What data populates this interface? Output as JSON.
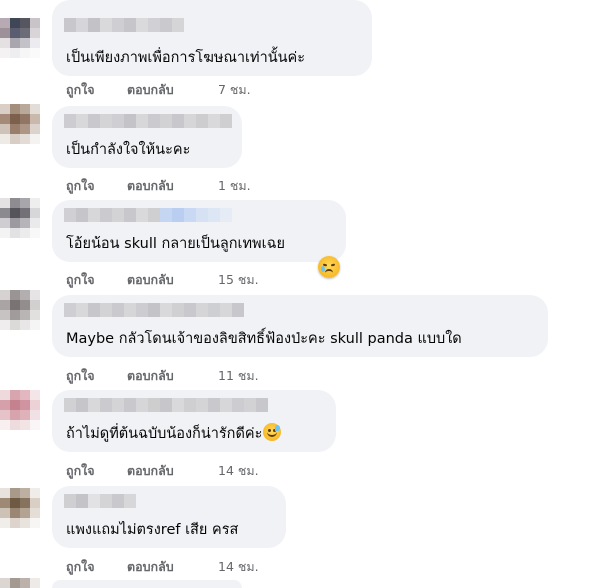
{
  "actions": {
    "like_label": "ถูกใจ",
    "reply_label": "ตอบกลับ"
  },
  "comments": [
    {
      "text": "เป็นเพียงภาพเพื่อการโฆษณาเท่านั้นค่ะ",
      "time": "7 ชม.",
      "emoji": null,
      "reaction": null
    },
    {
      "text": "เป็นกำลังใจให้นะคะ",
      "time": "1 ชม.",
      "emoji": null,
      "reaction": null
    },
    {
      "text": "โอ้ยน้อน skull กลายเป็นลูกเทพเฉย",
      "time": "15 ชม.",
      "emoji": null,
      "reaction": "sad-tear-icon"
    },
    {
      "text": "Maybe กลัวโดนเจ้าของลิขสิทธิ์ฟ้องป่ะคะ skull panda แบบใด",
      "time": "11 ชม.",
      "emoji": null,
      "reaction": null
    },
    {
      "text": "ถ้าไม่ดูที่ต้นฉบับน้องก็น่ารักดีค่ะ",
      "time": "14 ชม.",
      "emoji": "grinning-sweat-icon",
      "reaction": null
    },
    {
      "text": "แพงแถมไม่ตรงref เสีย ครส",
      "time": "14 ชม.",
      "emoji": null,
      "reaction": null
    }
  ],
  "colors": {
    "bubble": "#f0f2f5",
    "meta_text": "#65676b",
    "body_text": "#050505"
  }
}
